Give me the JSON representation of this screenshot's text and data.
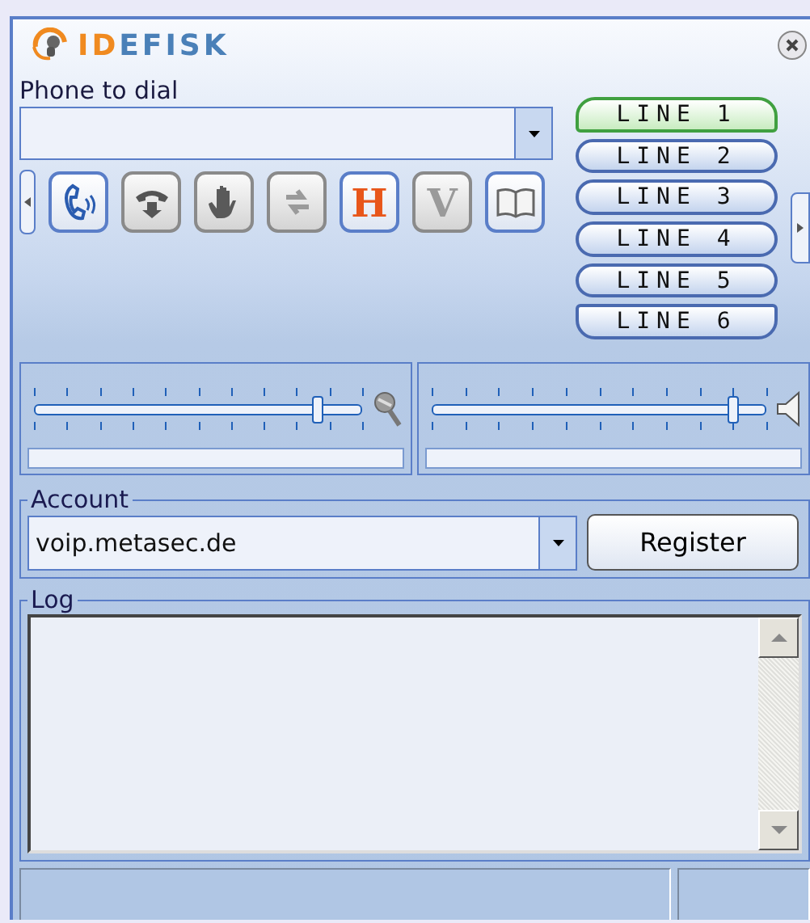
{
  "logo": {
    "accent": "ID",
    "rest": "EFISK"
  },
  "dial": {
    "label": "Phone to dial"
  },
  "toolbar": [
    {
      "kind": "call",
      "disabled": false
    },
    {
      "kind": "hangup",
      "disabled": true
    },
    {
      "kind": "hand",
      "disabled": true
    },
    {
      "kind": "transfer",
      "disabled": true
    },
    {
      "kind": "letter",
      "text": "H",
      "disabled": false
    },
    {
      "kind": "letter",
      "text": "V",
      "disabled": true
    },
    {
      "kind": "book",
      "disabled": false
    }
  ],
  "lines": [
    {
      "label": "LINE 1",
      "selected": true
    },
    {
      "label": "LINE 2",
      "selected": false
    },
    {
      "label": "LINE 3",
      "selected": false
    },
    {
      "label": "LINE 4",
      "selected": false
    },
    {
      "label": "LINE 5",
      "selected": false
    },
    {
      "label": "LINE 6",
      "selected": false
    }
  ],
  "sliders": [
    {
      "kind": "microphone",
      "level": 0.86
    },
    {
      "kind": "speaker",
      "level": 0.9
    }
  ],
  "account": {
    "title": "Account",
    "value": "voip.metasec.de",
    "button": "Register"
  },
  "log": {
    "title": "Log"
  }
}
